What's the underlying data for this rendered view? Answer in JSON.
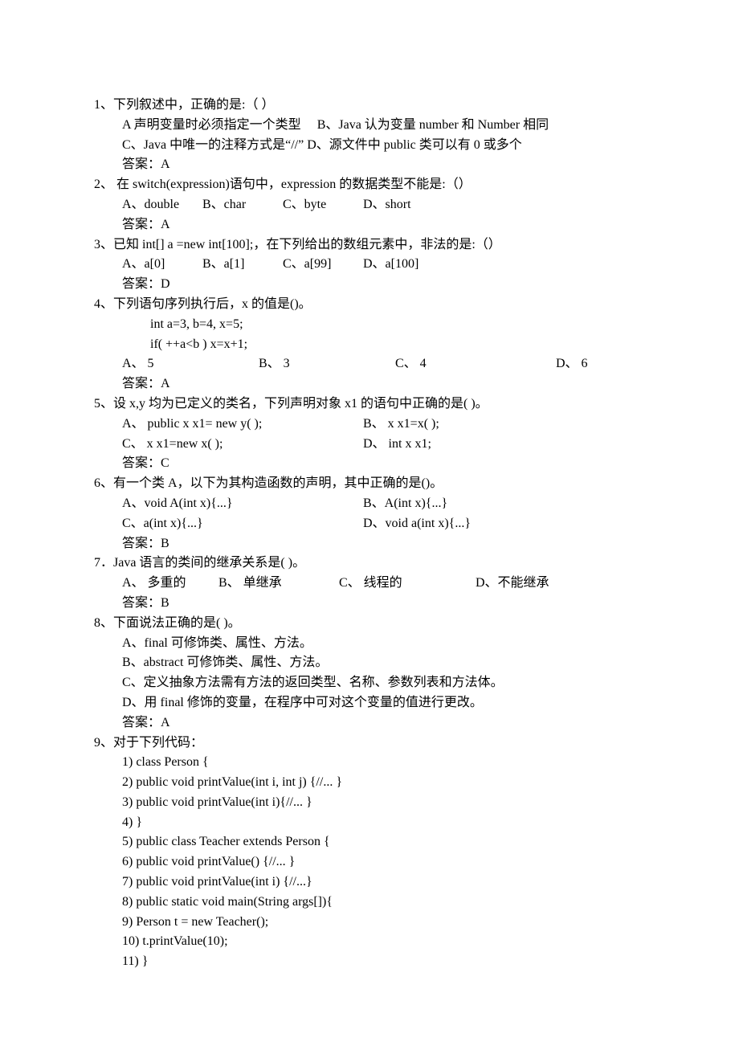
{
  "q1": {
    "stem": "1、下列叙述中，正确的是:（ ）",
    "optA": "A 声明变量时必须指定一个类型",
    "optB": "B、Java 认为变量 number 和 Number 相同",
    "optC": "C、Java 中唯一的注释方式是“//”",
    "optD": "D、源文件中 public 类可以有 0 或多个",
    "answer": "答案：A"
  },
  "q2": {
    "stem": "2、  在 switch(expression)语句中，expression 的数据类型不能是:（）",
    "optA": "A、double",
    "optB": "B、char",
    "optC": "C、byte",
    "optD": "D、short",
    "answer": "答案：A"
  },
  "q3": {
    "stem": "3、已知 int[] a =new int[100];，在下列给出的数组元素中，非法的是:（）",
    "optA": "A、a[0]",
    "optB": "B、a[1]",
    "optC": "C、a[99]",
    "optD": "D、a[100]",
    "answer": "答案：D"
  },
  "q4": {
    "stem": "4、下列语句序列执行后，x  的值是()。",
    "code1": "int a=3, b=4, x=5;",
    "code2": "if( ++a<b ) x=x+1;",
    "optA": "A、 5",
    "optB": "B、 3",
    "optC": "C、 4",
    "optD": "D、 6",
    "answer": "答案：A"
  },
  "q5": {
    "stem": "5、设  x,y 均为已定义的类名，下列声明对象 x1 的语句中正确的是( )。",
    "optA": "A、  public x x1= new y( );",
    "optB": "B、  x x1=x( );",
    "optC": "C、  x x1=new x( );",
    "optD": "D、  int x x1;",
    "answer": "答案：C"
  },
  "q6": {
    "stem": "6、有一个类 A，以下为其构造函数的声明，其中正确的是()。",
    "optA": "A、void A(int x){...}",
    "optB": "B、A(int x){...}",
    "optC": "C、a(int x){...}",
    "optD": "D、void a(int x){...}",
    "answer": "答案：B"
  },
  "q7": {
    "stem": "7．Java 语言的类间的继承关系是( )。",
    "optA": "A、 多重的",
    "optB": "B、 单继承",
    "optC": "C、 线程的",
    "optD": "D、不能继承",
    "answer": "答案：B"
  },
  "q8": {
    "stem": "8、下面说法正确的是( )。",
    "optA": "A、final  可修饰类、属性、方法。",
    "optB": "B、abstract 可修饰类、属性、方法。",
    "optC": "C、定义抽象方法需有方法的返回类型、名称、参数列表和方法体。",
    "optD": "D、用 final 修饰的变量，在程序中可对这个变量的值进行更改。",
    "answer": "答案：A"
  },
  "q9": {
    "stem": "9、对于下列代码：",
    "lines": [
      "1) class Person {",
      "2) public void printValue(int i, int j) {//... }",
      "3) public void printValue(int i){//... }",
      "4) }",
      "5) public class Teacher extends Person {",
      "6) public void printValue() {//... }",
      "7) public void printValue(int i) {//...}",
      "8) public static void main(String args[]){",
      "9) Person t = new Teacher();",
      "10) t.printValue(10);",
      "11) }"
    ]
  }
}
